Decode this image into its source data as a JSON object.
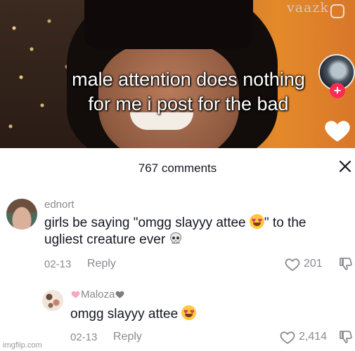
{
  "video": {
    "caption_line1": "male attention does nothing",
    "caption_line2": "for me i post for the bad",
    "watermark": "vaazk",
    "follow_symbol": "+"
  },
  "comments_panel": {
    "title": "767 comments",
    "close_symbol": "✕",
    "comments": [
      {
        "username": "ednort",
        "text_line1_before_emoji": "girls be saying \"omgg slayyy attee ",
        "text_line1_after_emoji": "\" to the",
        "text_line2": "ugliest creature ever ",
        "emoji": "heart-eyes",
        "trailing_emoji": "skull",
        "date": "02-13",
        "reply_label": "Reply",
        "likes": "201"
      },
      {
        "username_prefix_emoji": "pink-heart",
        "username": "Maloza",
        "username_suffix_emoji": "grey-heart",
        "text": "omgg slayyy attee ",
        "emoji": "heart-eyes",
        "date": "02-13",
        "reply_label": "Reply",
        "likes": "2,414"
      }
    ]
  },
  "footer": {
    "site_watermark": "imgflip.com"
  },
  "colors": {
    "follow_red": "#fe2c55",
    "secondary_text": "#8a8b91",
    "primary_text": "#161823"
  }
}
